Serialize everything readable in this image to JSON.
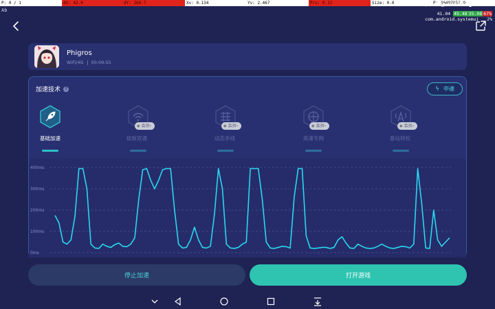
{
  "debug": {
    "cells": [
      "P: 0 / 1",
      "dX: 42.0",
      "dY: 260.7",
      "Xv: 0.134",
      "Yv: 2.467",
      "Prs: 0.11",
      "Size: 0.0",
      "P: 36497052.0"
    ]
  },
  "status_bar": {
    "network": "10.1K/s",
    "battery": "56%",
    "time": "03:01"
  },
  "sys_overlay": {
    "line1_prefix": "41.04",
    "line1_green": "45.48",
    "line1_mid": "35.08",
    "line1_red": "67%",
    "line2": "com.android.systemui",
    "line2_value": "2%"
  },
  "ab_label": "Ab",
  "game": {
    "title": "Phigros",
    "network": "WiFi/4G",
    "duration": "00:09:55"
  },
  "panel": {
    "title": "加速技术",
    "help": "?",
    "mode": "中速",
    "mode_icon": "lightning-icon"
  },
  "techs": [
    {
      "label": "基础加速",
      "active": true,
      "icon": "rocket-icon"
    },
    {
      "label": "极致双通",
      "active": false,
      "badge": "会员",
      "icon": "wifi-dual-icon"
    },
    {
      "label": "动态多线",
      "active": false,
      "badge": "会员",
      "icon": "multiline-icon"
    },
    {
      "label": "高速专网",
      "active": false,
      "badge": "会员",
      "icon": "globe-icon"
    },
    {
      "label": "基站转权",
      "active": false,
      "badge": "会员",
      "icon": "tower-icon"
    }
  ],
  "chart_data": {
    "type": "line",
    "ylabel": "",
    "yticks": [
      "400ms",
      "300ms",
      "200ms",
      "100ms",
      "0ms"
    ],
    "ylim": [
      0,
      400
    ],
    "grid": true,
    "series": [
      {
        "values": [
          175,
          140,
          50,
          40,
          60,
          170,
          395,
          395,
          300,
          40,
          22,
          20,
          40,
          30,
          25,
          38,
          45,
          30,
          28,
          40,
          70,
          250,
          390,
          395,
          340,
          300,
          340,
          390,
          395,
          395,
          200,
          40,
          22,
          25,
          60,
          120,
          60,
          25,
          22,
          30,
          180,
          395,
          300,
          40,
          22,
          20,
          25,
          40,
          50,
          395,
          395,
          395,
          250,
          50,
          22,
          20,
          25,
          30,
          28,
          22,
          260,
          395,
          395,
          80,
          22,
          20,
          22,
          25,
          25,
          20,
          25,
          60,
          75,
          45,
          22,
          20,
          40,
          30,
          22,
          20,
          22,
          30,
          40,
          30,
          22,
          20,
          25,
          30,
          28,
          22,
          40,
          395,
          230,
          22,
          20,
          200,
          60,
          30,
          50,
          70
        ]
      }
    ]
  },
  "buttons": {
    "stop": "停止加速",
    "open": "打开游戏"
  }
}
